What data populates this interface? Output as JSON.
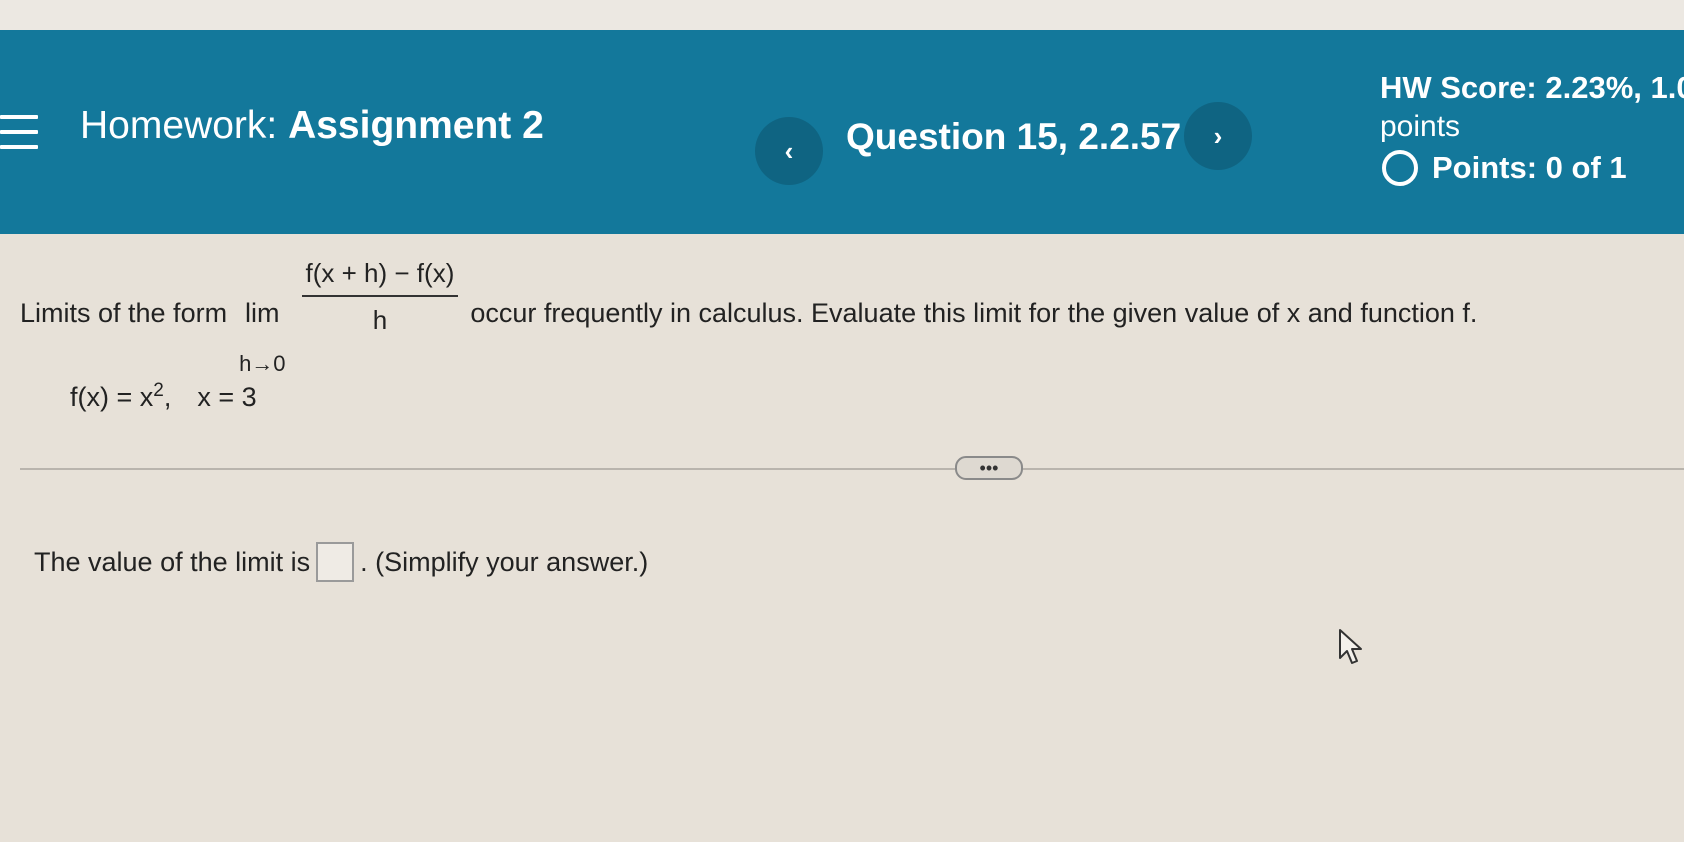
{
  "header": {
    "menu_icon": "hamburger-menu-icon",
    "homework_prefix": "Homework:",
    "assignment_name": "Assignment 2",
    "prev_icon": "‹",
    "question_label": "Question 15, 2.2.57",
    "next_icon": "›",
    "hw_score": "HW Score: 2.23%, 1.0",
    "points_word": "points",
    "points_status": "Points: 0 of 1",
    "colors": {
      "bar": "#13789b",
      "nav_button": "#0f6482"
    }
  },
  "question": {
    "intro": "Limits of the form",
    "lim": "lim",
    "lim_sub": "h→0",
    "numerator": "f(x + h) − f(x)",
    "denominator": "h",
    "outro": "occur frequently in calculus. Evaluate this limit for the given value of x and function f.",
    "func_lhs": "f(x) = x",
    "func_exp": "2",
    "func_comma": ",",
    "x_value": "x = 3"
  },
  "expand_label": "•••",
  "answer": {
    "prefix": "The value of the limit is",
    "suffix": ". (Simplify your answer.)"
  }
}
